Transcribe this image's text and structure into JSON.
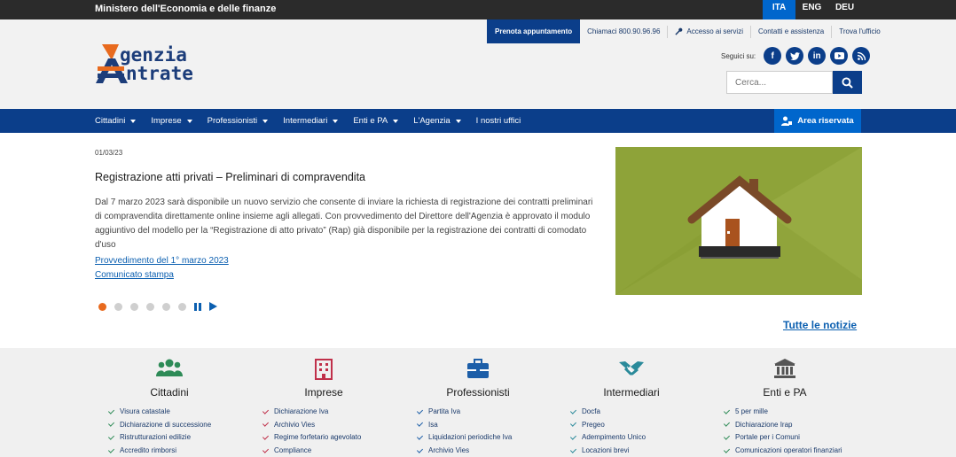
{
  "topbar": {
    "ministry": "Ministero dell'Economia e delle finanze",
    "languages": [
      {
        "label": "ITA",
        "active": true
      },
      {
        "label": "ENG",
        "active": false
      },
      {
        "label": "DEU",
        "active": false
      }
    ]
  },
  "utility": {
    "appointment": "Prenota appuntamento",
    "call": "Chiamaci 800.90.96.96",
    "services": "Accesso ai servizi",
    "contacts": "Contatti e assistenza",
    "office": "Trova l'ufficio"
  },
  "logo": {
    "line1": "genzia",
    "line2": "ntrate"
  },
  "social": {
    "label": "Seguici su:",
    "icons": [
      "facebook-icon",
      "twitter-icon",
      "linkedin-icon",
      "youtube-icon",
      "rss-icon"
    ]
  },
  "search": {
    "placeholder": "Cerca..."
  },
  "nav": {
    "items": [
      "Cittadini",
      "Imprese",
      "Professionisti",
      "Intermediari",
      "Enti e PA",
      "L'Agenzia",
      "I nostri uffici"
    ],
    "area": "Area riservata"
  },
  "news": {
    "date": "01/03/23",
    "title": "Registrazione atti privati – Preliminari di compravendita",
    "body": "Dal 7 marzo 2023 sarà disponibile un nuovo servizio che consente di inviare la richiesta di registrazione dei contratti preliminari di compravendita direttamente online insieme agli allegati. Con provvedimento del Direttore dell'Agenzia è approvato il modulo aggiuntivo del modello per la “Registrazione di atto privato” (Rap) già disponibile per la registrazione dei contratti di comodato d'uso",
    "link1": "Provvedimento del 1° marzo 2023",
    "link2": "Comunicato stampa",
    "all_news": "Tutte le notizie",
    "slide_count": 6,
    "active_slide": 1
  },
  "colors": {
    "brand_blue": "#0b3e8a",
    "accent_blue": "#0066cc",
    "orange": "#e86a1e",
    "image_green": "#8ea339"
  },
  "categories": [
    {
      "title": "Cittadini",
      "icon": "users-icon",
      "color": "#2e8b57",
      "links": [
        "Visura catastale",
        "Dichiarazione di successione",
        "Ristrutturazioni edilizie",
        "Accredito rimborsi"
      ]
    },
    {
      "title": "Imprese",
      "icon": "building-icon",
      "color": "#c0304a",
      "links": [
        "Dichiarazione Iva",
        "Archivio Vies",
        "Regime forfetario agevolato",
        "Compliance"
      ]
    },
    {
      "title": "Professionisti",
      "icon": "briefcase-icon",
      "color": "#1c5ea8",
      "links": [
        "Partita Iva",
        "Isa",
        "Liquidazioni periodiche Iva",
        "Archivio Vies"
      ]
    },
    {
      "title": "Intermediari",
      "icon": "handshake-icon",
      "color": "#2a8a9a",
      "links": [
        "Docfa",
        "Pregeo",
        "Adempimento Unico",
        "Locazioni brevi"
      ]
    },
    {
      "title": "Enti e PA",
      "icon": "institution-icon",
      "color": "#555555",
      "links": [
        "5 per mille",
        "Dichiarazione Irap",
        "Portale per i Comuni",
        "Comunicazioni operatori finanziari"
      ]
    }
  ]
}
